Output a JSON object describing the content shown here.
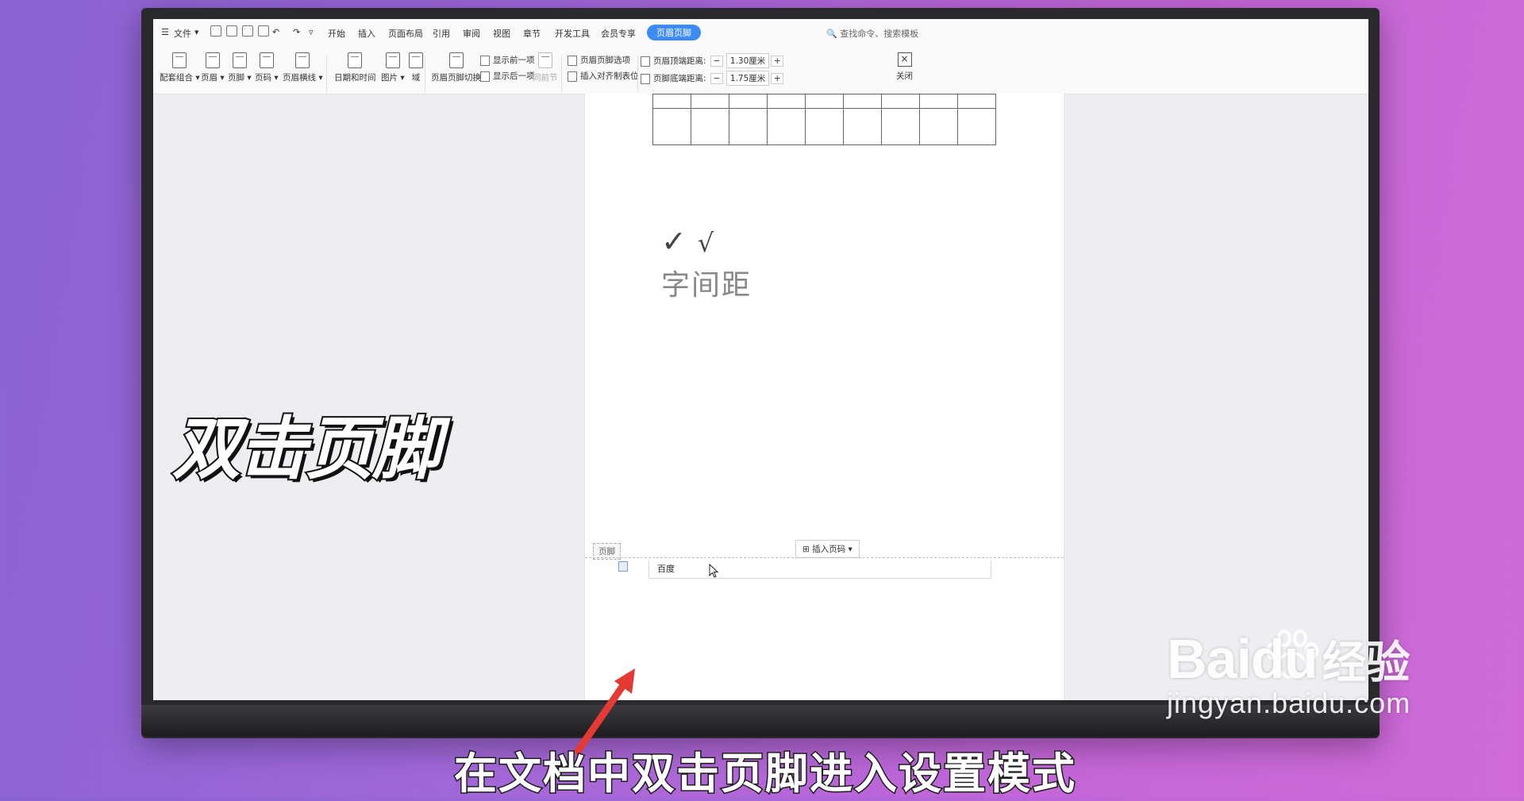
{
  "menu": {
    "file": "文件",
    "tabs": [
      "开始",
      "插入",
      "页面布局",
      "引用",
      "审阅",
      "视图",
      "章节",
      "开发工具",
      "会员专享",
      "页眉页脚"
    ],
    "active_tab": "页眉页脚",
    "search_placeholder": "查找命令、搜索模板"
  },
  "tools": {
    "combo": "配套组合",
    "header": "页眉",
    "footer": "页脚",
    "page_number": "页码",
    "header_line": "页眉横线",
    "date_time": "日期和时间",
    "picture": "图片",
    "field": "域",
    "switch": "页眉页脚切换",
    "show_prev": "显示前一项",
    "show_next": "显示后一项",
    "same_as_prev": "同前节",
    "hf_options": "页眉页脚选项",
    "insert_align_tab": "插入对齐制表位",
    "header_top_label": "页眉顶端距离:",
    "header_top_value": "1.30厘米",
    "footer_bottom_label": "页脚底端距离:",
    "footer_bottom_value": "1.75厘米",
    "close": "关闭"
  },
  "document": {
    "checks": [
      "✓",
      "√"
    ],
    "text": "字间距",
    "footer_tag": "页脚",
    "insert_page_number": "插入页码",
    "footer_content": "百度"
  },
  "overlay": {
    "title": "双击页脚",
    "caption": "在文档中双击页脚进入设置模式"
  },
  "watermark": {
    "brand": "Baidu",
    "brand_cn": "经验",
    "url": "jingyan.baidu.com"
  },
  "colors": {
    "accent": "#3d8cf5",
    "arrow": "#e53935"
  }
}
